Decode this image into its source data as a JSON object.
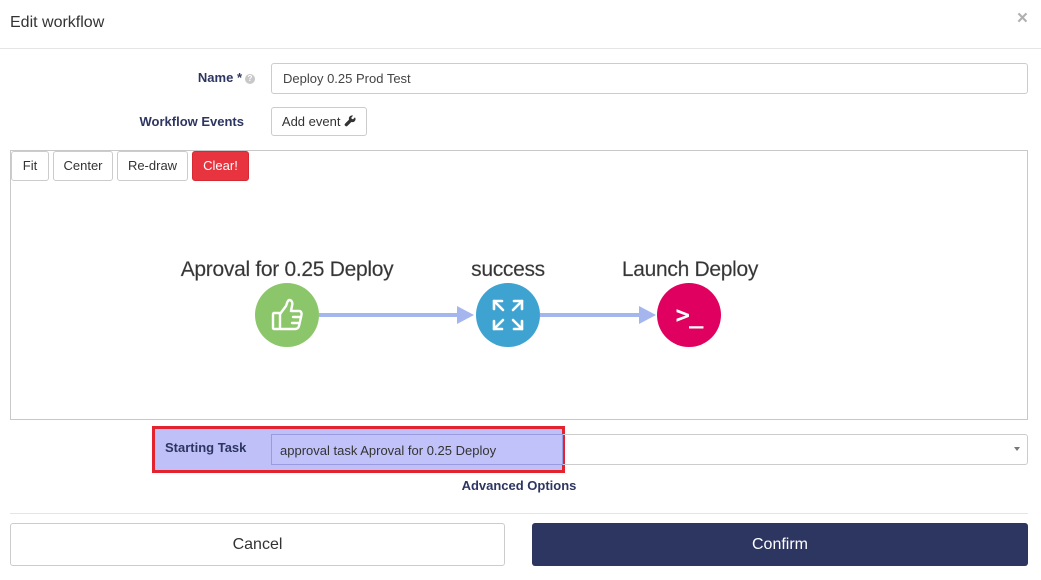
{
  "modal": {
    "title": "Edit workflow",
    "close_glyph": "×"
  },
  "form": {
    "name_label": "Name *",
    "name_help_icon": "?",
    "name_value": "Deploy 0.25 Prod Test",
    "events_label": "Workflow Events",
    "add_event_label": "Add event"
  },
  "toolbar": {
    "fit": "Fit",
    "center": "Center",
    "redraw": "Re-draw",
    "clear": "Clear!"
  },
  "graph": {
    "nodes": [
      {
        "label": "Aproval for 0.25 Deploy",
        "icon": "thumbs-up-icon",
        "color": "#8cc66a"
      },
      {
        "label": "success",
        "icon": "expand-arrows-icon",
        "color": "#3ea3d0"
      },
      {
        "label": "Launch Deploy",
        "icon": "terminal-icon",
        "color": "#e0005f"
      }
    ],
    "edge_color": "#a5b6ee",
    "terminal_glyph": ">_"
  },
  "starting_task": {
    "label": "Starting Task",
    "value": "approval task Aproval for 0.25 Deploy"
  },
  "advanced_options_label": "Advanced Options",
  "footer": {
    "cancel": "Cancel",
    "confirm": "Confirm"
  },
  "colors": {
    "primary": "#2d3561",
    "danger": "#e8343f",
    "highlight_border": "#e3232e",
    "highlight_fill": "#bfc0f8"
  }
}
